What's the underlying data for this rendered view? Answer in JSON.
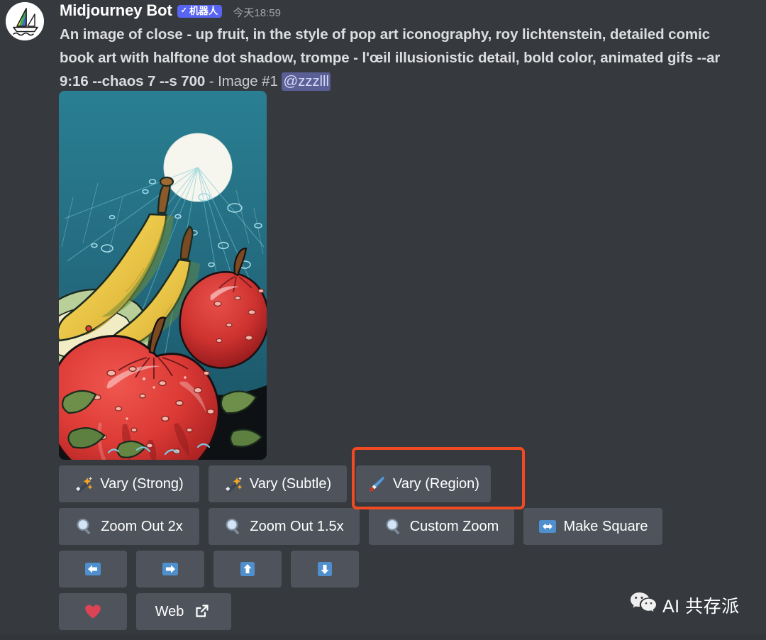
{
  "message": {
    "author": "Midjourney Bot",
    "bot_badge": "机器人",
    "bot_check": "✓",
    "timestamp": "今天18:59",
    "prompt": "An image of close - up fruit, in the style of pop art iconography, roy lichtenstein, detailed comic book art with halftone dot shadow, trompe - l'œil illusionistic detail, bold color, animated gifs --ar 9:16 --chaos 7 --s 700",
    "suffix": " - Image #1 ",
    "mention": "@zzzlll"
  },
  "avatar": {
    "icon": "midjourney-sailboat-logo"
  },
  "generated_image": {
    "alt": "Pop art close-up of red apples and bananas with water droplets on teal background",
    "description": "comic book style fruit illustration"
  },
  "buttons": {
    "row1": [
      {
        "id": "vary-strong",
        "label": "Vary (Strong)",
        "icon": "magic-wand-icon"
      },
      {
        "id": "vary-subtle",
        "label": "Vary (Subtle)",
        "icon": "magic-wand-icon"
      },
      {
        "id": "vary-region",
        "label": "Vary (Region)",
        "icon": "paintbrush-icon"
      }
    ],
    "row2": [
      {
        "id": "zoom-out-2x",
        "label": "Zoom Out 2x",
        "icon": "magnifying-glass-icon"
      },
      {
        "id": "zoom-out-15x",
        "label": "Zoom Out 1.5x",
        "icon": "magnifying-glass-icon"
      },
      {
        "id": "custom-zoom",
        "label": "Custom Zoom",
        "icon": "magnifying-glass-icon"
      },
      {
        "id": "make-square",
        "label": "Make Square",
        "icon": "left-right-arrow-icon"
      }
    ],
    "row3": [
      {
        "id": "pan-left",
        "label": "",
        "icon": "arrow-left-icon"
      },
      {
        "id": "pan-right",
        "label": "",
        "icon": "arrow-right-icon"
      },
      {
        "id": "pan-up",
        "label": "",
        "icon": "arrow-up-icon"
      },
      {
        "id": "pan-down",
        "label": "",
        "icon": "arrow-down-icon"
      }
    ],
    "row4": [
      {
        "id": "favorite",
        "label": "",
        "icon": "heart-icon"
      },
      {
        "id": "web",
        "label": "Web",
        "icon": "external-link-icon"
      }
    ]
  },
  "annotation": {
    "target": "vary-region",
    "color": "#f04a23"
  },
  "watermark": {
    "text": "AI 共存派",
    "icon": "wechat-icon"
  },
  "colors": {
    "background": "#36393e",
    "button": "#4f545c",
    "accent_blurple": "#5865f2",
    "annotation_orange": "#f04a23",
    "heart_red": "#dc4455",
    "arrow_blue": "#4f8fce"
  }
}
